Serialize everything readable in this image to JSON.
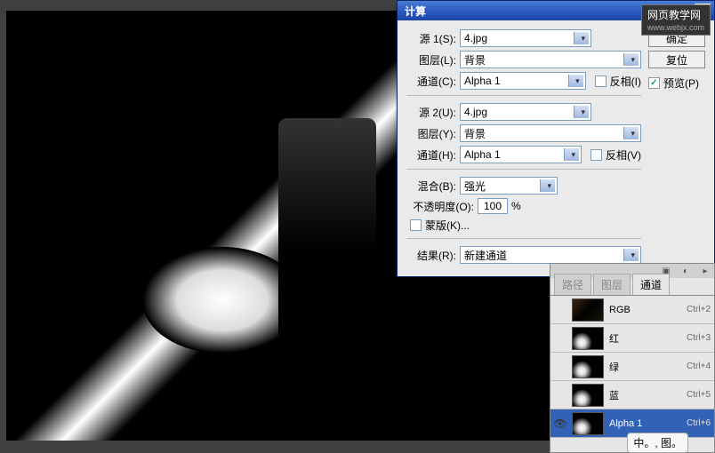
{
  "watermark": {
    "title": "网页教学网",
    "url": "www.webjx.com"
  },
  "dialog": {
    "title": "计算",
    "close": "×",
    "source1": {
      "label": "源 1(S):",
      "value": "4.jpg",
      "layer_label": "图层(L):",
      "layer_value": "背景",
      "channel_label": "通道(C):",
      "channel_value": "Alpha 1",
      "invert_label": "反相(I)"
    },
    "source2": {
      "label": "源 2(U):",
      "value": "4.jpg",
      "layer_label": "图层(Y):",
      "layer_value": "背景",
      "channel_label": "通道(H):",
      "channel_value": "Alpha 1",
      "invert_label": "反相(V)"
    },
    "blending": {
      "label": "混合(B):",
      "value": "强光",
      "opacity_label": "不透明度(O):",
      "opacity_value": "100",
      "opacity_suffix": "%",
      "mask_label": "蒙版(K)..."
    },
    "result": {
      "label": "结果(R):",
      "value": "新建通道"
    },
    "buttons": {
      "ok": "确定",
      "reset": "复位",
      "preview": "预览(P)"
    }
  },
  "panel": {
    "tabs": {
      "paths": "路径",
      "layers": "图层",
      "channels": "通道"
    },
    "channels": [
      {
        "name": "RGB",
        "shortcut": "Ctrl+2",
        "thumb": "rgb"
      },
      {
        "name": "红",
        "shortcut": "Ctrl+3",
        "thumb": "bw"
      },
      {
        "name": "绿",
        "shortcut": "Ctrl+4",
        "thumb": "bw"
      },
      {
        "name": "蓝",
        "shortcut": "Ctrl+5",
        "thumb": "bw"
      },
      {
        "name": "Alpha 1",
        "shortcut": "Ctrl+6",
        "thumb": "bw",
        "selected": true,
        "visible": true
      }
    ]
  },
  "mascot": "中。, 图。"
}
